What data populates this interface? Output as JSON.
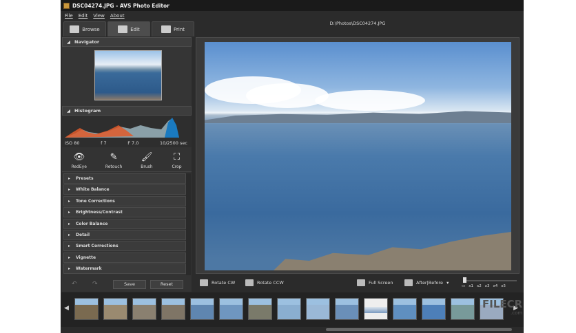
{
  "window": {
    "title": "DSC04274.JPG  -  AVS Photo Editor"
  },
  "menu": [
    "File",
    "Edit",
    "View",
    "About"
  ],
  "tabs": [
    {
      "label": "Browse"
    },
    {
      "label": "Edit"
    },
    {
      "label": "Print"
    }
  ],
  "file_path": "D:\\Photos\\DSC04274.JPG",
  "navigator": {
    "title": "Navigator"
  },
  "histogram": {
    "title": "Histogram",
    "iso": "ISO 80",
    "f1": "f 7",
    "f2": "F 7.0",
    "shutter": "10/2500 sec"
  },
  "tools": [
    {
      "label": "RedEye",
      "glyph": "👁"
    },
    {
      "label": "Retouch",
      "glyph": "✎"
    },
    {
      "label": "Brush",
      "glyph": "🖌"
    },
    {
      "label": "Crop",
      "glyph": "⛶"
    }
  ],
  "sections": [
    "Presets",
    "White Balance",
    "Tone Corrections",
    "Brightness/Contrast",
    "Color Balance",
    "Detail",
    "Smart Corrections",
    "Vignette",
    "Watermark"
  ],
  "buttons": {
    "save": "Save",
    "reset": "Reset"
  },
  "toolbar": {
    "rotate_cw": "Rotate CW",
    "rotate_ccw": "Rotate CCW",
    "full_screen": "Full Screen",
    "after_before": "After|Before"
  },
  "zoom_marks": [
    "x1",
    "x2",
    "x3",
    "x4",
    "x5"
  ],
  "filmstrip": {
    "count": 15,
    "selected_index": 10,
    "colors": [
      "#7a6a50",
      "#9a8a70",
      "#8a8070",
      "#7f7566",
      "#5f86b0",
      "#6f96c0",
      "#7a7a6a",
      "#8aaed0",
      "#9ab8d6",
      "#6a8fb8",
      "#dde6ee",
      "#5f8fc0",
      "#4d7fb8",
      "#789a9a",
      "#9aaac0"
    ]
  },
  "watermark": {
    "text": "FILECR",
    "sub": ".com"
  }
}
